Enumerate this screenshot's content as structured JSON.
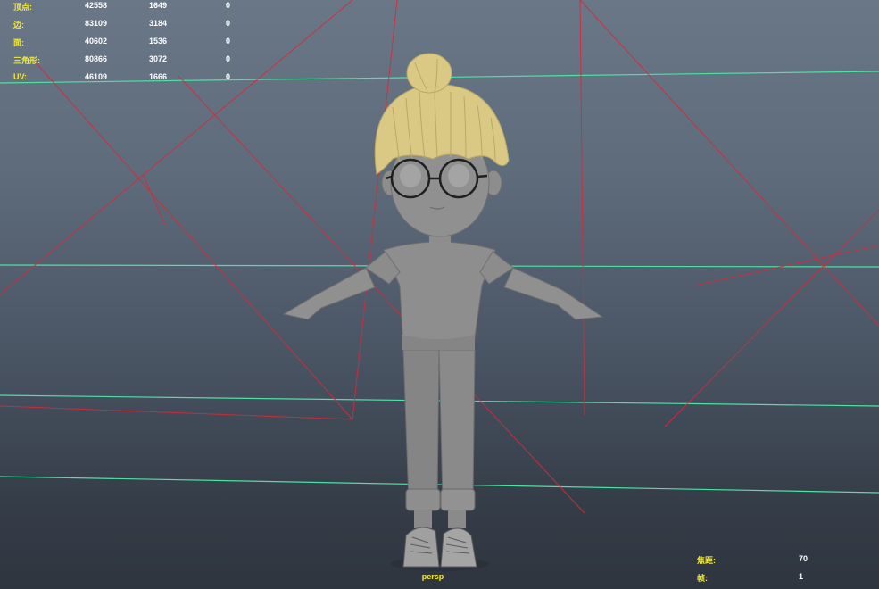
{
  "viewport": {
    "camera": "persp",
    "background_top": "#6a7787",
    "background_bottom": "#2e353f",
    "grid_color": "#4fe0a4",
    "camera_line_color": "#d62a3a"
  },
  "hud_stats": {
    "rows": [
      {
        "label": "顶点:",
        "total": "42558",
        "selected": "1649",
        "components": "0"
      },
      {
        "label": "边:",
        "total": "83109",
        "selected": "3184",
        "components": "0"
      },
      {
        "label": "面:",
        "total": "40602",
        "selected": "1536",
        "components": "0"
      },
      {
        "label": "三角形:",
        "total": "80866",
        "selected": "3072",
        "components": "0"
      },
      {
        "label": "UV:",
        "total": "46109",
        "selected": "1666",
        "components": "0"
      }
    ],
    "label_color": "#f3e93a",
    "value_color": "#ffffff"
  },
  "hud_camera": {
    "focal_label": "焦距:",
    "focal_value": "70",
    "frame_label": "帧:",
    "frame_value": "1"
  },
  "model": {
    "hair_color": "#e0d08a",
    "body_color": "#8c8c8c"
  }
}
